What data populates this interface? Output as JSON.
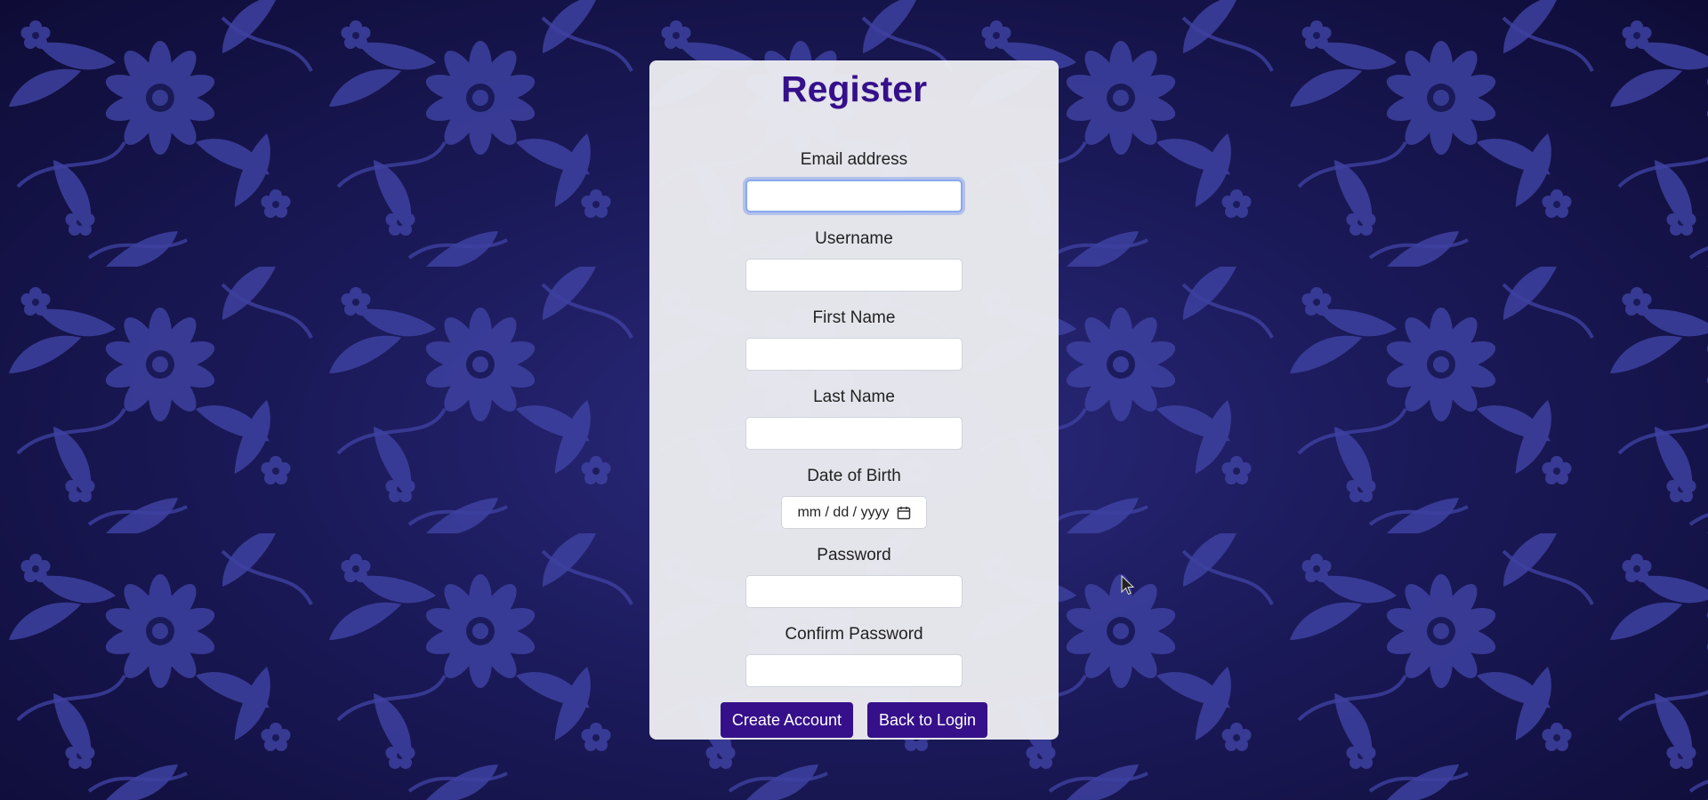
{
  "page": {
    "title": "Register"
  },
  "form": {
    "fields": [
      {
        "label": "Email address",
        "value": "",
        "focused": true
      },
      {
        "label": "Username",
        "value": ""
      },
      {
        "label": "First Name",
        "value": ""
      },
      {
        "label": "Last Name",
        "value": ""
      },
      {
        "label": "Date of Birth",
        "placeholder": "mm / dd / yyyy"
      },
      {
        "label": "Password",
        "value": ""
      },
      {
        "label": "Confirm Password",
        "value": ""
      }
    ],
    "buttons": {
      "create_account": "Create Account",
      "back_to_login": "Back to Login"
    }
  },
  "icons": {
    "calendar": "calendar-icon",
    "cursor": "mouse-pointer-icon",
    "background": "floral-pattern"
  },
  "colors": {
    "accent": "#35108a",
    "background": "#1b1a5a",
    "pattern": "#3c3f9e",
    "card": "#ececf0",
    "focus_ring": "#8aa9ee"
  }
}
